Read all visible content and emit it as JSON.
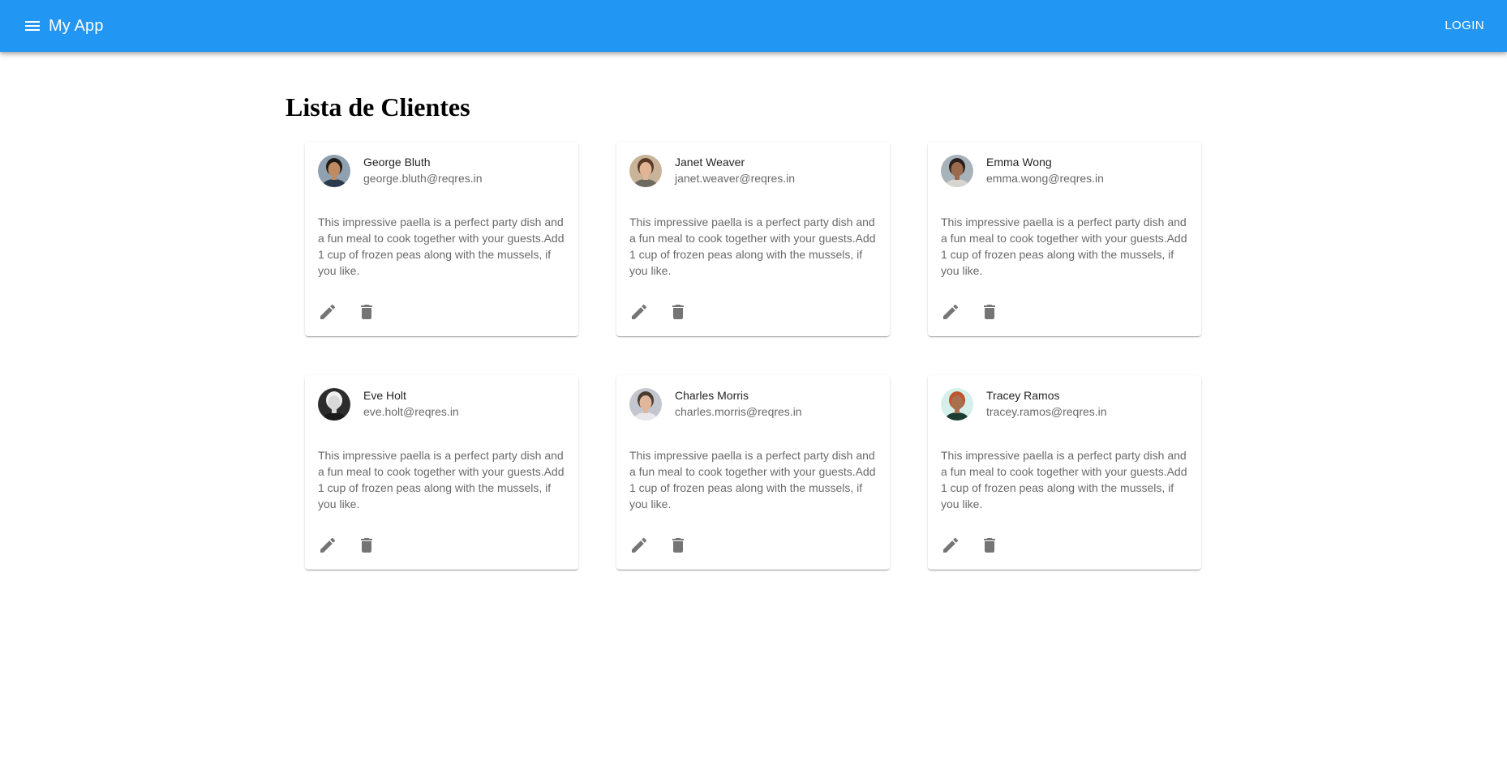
{
  "appbar": {
    "title": "My App",
    "menu_icon": "menu-icon",
    "login_label": "LOGIN",
    "color": "#2196f3"
  },
  "main": {
    "title": "Lista de Clientes"
  },
  "clients": [
    {
      "name": "George Bluth",
      "email": "george.bluth@reqres.in",
      "description": "This impressive paella is a perfect party dish and a fun meal to cook together with your guests.Add 1 cup of frozen peas along with the mussels, if you like.",
      "avatar": {
        "bg": "#8fa0b0",
        "skin": "#c08a62",
        "hair": "#1e1a18",
        "shirt": "#2b3a4d"
      }
    },
    {
      "name": "Janet Weaver",
      "email": "janet.weaver@reqres.in",
      "description": "This impressive paella is a perfect party dish and a fun meal to cook together with your guests.Add 1 cup of frozen peas along with the mussels, if you like.",
      "avatar": {
        "bg": "#c9b49a",
        "skin": "#e2b595",
        "hair": "#5a3a26",
        "shirt": "#6e6a62"
      }
    },
    {
      "name": "Emma Wong",
      "email": "emma.wong@reqres.in",
      "description": "This impressive paella is a perfect party dish and a fun meal to cook together with your guests.Add 1 cup of frozen peas along with the mussels, if you like.",
      "avatar": {
        "bg": "#a7b2bb",
        "skin": "#9c6b4e",
        "hair": "#2a211c",
        "shirt": "#d8d4cf"
      }
    },
    {
      "name": "Eve Holt",
      "email": "eve.holt@reqres.in",
      "description": "This impressive paella is a perfect party dish and a fun meal to cook together with your guests.Add 1 cup of frozen peas along with the mussels, if you like.",
      "avatar": {
        "bg": "#2d2d2d",
        "skin": "#d9d9d9",
        "hair": "#f2f2f2",
        "shirt": "#1a1a1a"
      }
    },
    {
      "name": "Charles Morris",
      "email": "charles.morris@reqres.in",
      "description": "This impressive paella is a perfect party dish and a fun meal to cook together with your guests.Add 1 cup of frozen peas along with the mussels, if you like.",
      "avatar": {
        "bg": "#c3c6cf",
        "skin": "#e0b79b",
        "hair": "#4a3b30",
        "shirt": "#e8e8ec"
      }
    },
    {
      "name": "Tracey Ramos",
      "email": "tracey.ramos@reqres.in",
      "description": "This impressive paella is a perfect party dish and a fun meal to cook together with your guests.Add 1 cup of frozen peas along with the mussels, if you like.",
      "avatar": {
        "bg": "#d5efea",
        "skin": "#a8704d",
        "hair": "#c0532f",
        "shirt": "#1b3b32"
      }
    }
  ],
  "card_actions": {
    "edit_icon": "pencil-icon",
    "delete_icon": "trash-icon",
    "icon_color": "#757575"
  }
}
